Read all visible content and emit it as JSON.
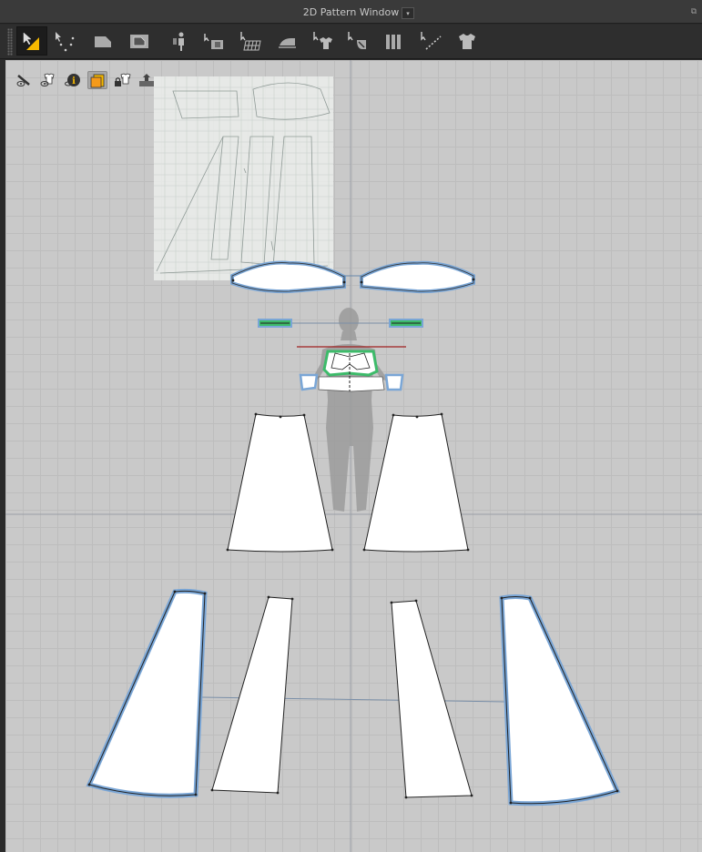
{
  "window": {
    "title": "2D Pattern Window",
    "dropdown_glyph": "▾",
    "float_glyph": "⧉"
  },
  "toolbar": {
    "tools": [
      {
        "name": "transform-pattern-tool",
        "active": true
      },
      {
        "name": "edit-point-tool",
        "active": false
      },
      {
        "name": "polygon-tool",
        "active": false
      },
      {
        "name": "internal-polygon-tool",
        "active": false
      },
      {
        "name": "avatar-arrangement-tool",
        "active": false
      },
      {
        "name": "fold-arrangement-tool",
        "active": false
      },
      {
        "name": "mesh-grid-tool",
        "active": false
      },
      {
        "name": "iron-tool",
        "active": false
      },
      {
        "name": "garment-fitting-tool",
        "active": false
      },
      {
        "name": "pin-tool",
        "active": false
      },
      {
        "name": "pleats-tool",
        "active": false
      },
      {
        "name": "seam-line-tool",
        "active": false
      },
      {
        "name": "garment-tool",
        "active": false
      }
    ]
  },
  "view_controls": [
    {
      "name": "show-hide-icon",
      "active": false
    },
    {
      "name": "avatar-visibility-icon",
      "active": false
    },
    {
      "name": "info-icon",
      "active": false
    },
    {
      "name": "fabric-color-icon",
      "active": true
    },
    {
      "name": "lock-garment-icon",
      "active": false
    },
    {
      "name": "export-icon",
      "active": false
    }
  ],
  "colors": {
    "canvas_bg": "#c9c9c9",
    "grid_line": "#bdbdbd",
    "pattern_fill": "#ffffff",
    "selected_outline": "#7aa6d6",
    "active_seam": "#3dbb6a",
    "red_line": "#a02020",
    "avatar_silhouette": "#9b9b9b",
    "toolbar_bg": "#2e2e2e",
    "accent": "#f5b800"
  }
}
